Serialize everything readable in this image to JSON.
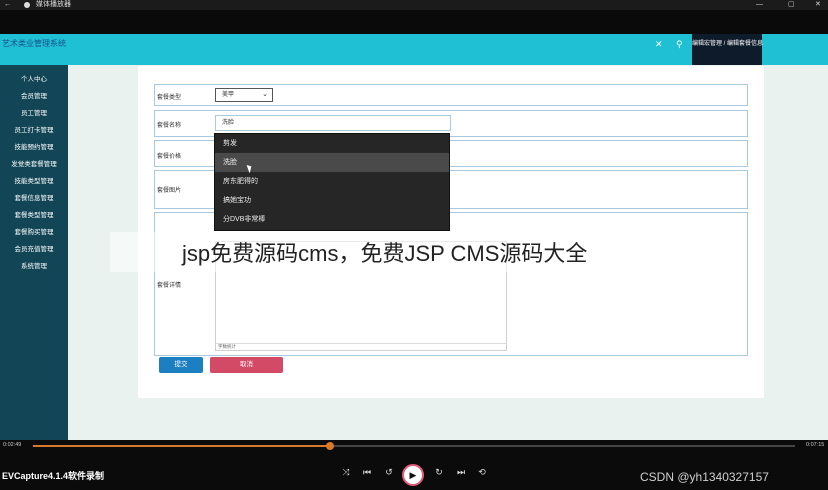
{
  "window": {
    "back_icon": "back-arrow-icon",
    "title": "媒体播放器",
    "minimize": "—",
    "maximize": "▢",
    "close": "✕"
  },
  "app": {
    "brand": "艺术类业管理系统",
    "close_symbol": "✕",
    "user_symbol": "⚲",
    "crumb": "编辑宏管理 / 编辑套餐信息"
  },
  "sidebar": {
    "items": [
      {
        "label": "个人中心"
      },
      {
        "label": "会员管理"
      },
      {
        "label": "员工管理"
      },
      {
        "label": "员工打卡管理"
      },
      {
        "label": "技能预约管理"
      },
      {
        "label": "发觉类套餐管理"
      },
      {
        "label": "技能类型管理"
      },
      {
        "label": "套餐信息管理"
      },
      {
        "label": "套餐类型管理"
      },
      {
        "label": "套餐购买管理"
      },
      {
        "label": "会员充值管理"
      },
      {
        "label": "系统管理"
      }
    ]
  },
  "form": {
    "type_label": "套餐类型",
    "type_value": "美甲",
    "name_label": "套餐名称",
    "name_value": "洗脸",
    "price_label": "套餐价格",
    "image_label": "套餐图片",
    "detail_label": "套餐详情",
    "editor_status": "字数统计",
    "submit_label": "提交",
    "cancel_label": "取消",
    "dropdown_options": [
      {
        "label": "剪发",
        "highlighted": false
      },
      {
        "label": "洗脸",
        "highlighted": true
      },
      {
        "label": "房东肥得的",
        "highlighted": false
      },
      {
        "label": "搞她宝功",
        "highlighted": false
      },
      {
        "label": "分DVB非常棒",
        "highlighted": false
      }
    ]
  },
  "overlay": {
    "text": "jsp免费源码cms，免费JSP CMS源码大全"
  },
  "player": {
    "time_current": "0:02:49",
    "time_total": "0:07:15",
    "progress_fraction": 0.39,
    "recorder_label": "EVCapture4.1.4软件录制",
    "controls": {
      "shuffle": "⤨",
      "prev": "⏮",
      "back10": "↺",
      "play": "▶",
      "fwd30": "↻",
      "next": "⏭",
      "repeat": "⟲"
    },
    "watermark": "CSDN @yh1340327157"
  },
  "colors": {
    "header": "#1fc0d4",
    "sidebar": "#124656",
    "submit": "#1b7fc1",
    "cancel": "#d24a66",
    "progress": "#d97a2a"
  }
}
